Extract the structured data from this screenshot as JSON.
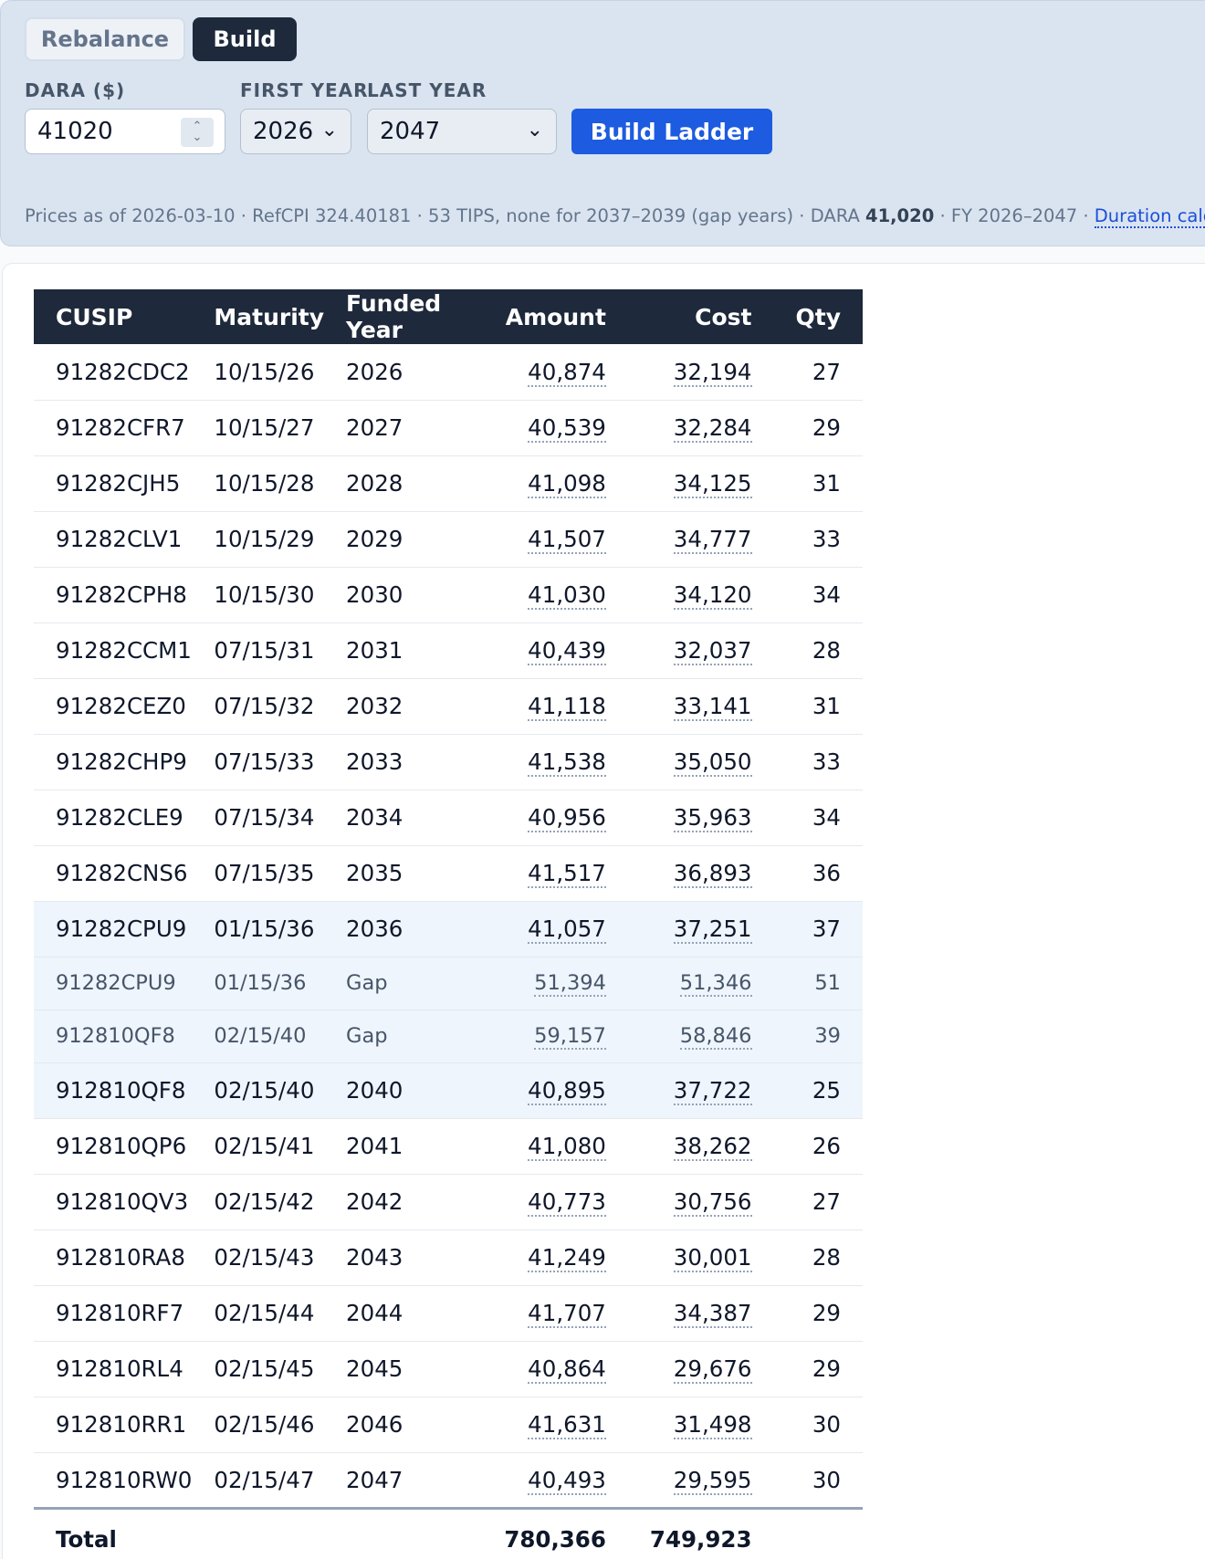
{
  "tabs": [
    {
      "label": "Rebalance",
      "active": false
    },
    {
      "label": "Build",
      "active": true
    }
  ],
  "form": {
    "dara_label": "DARA ($)",
    "dara_value": "41020",
    "first_year_label": "FIRST YEAR",
    "first_year_value": "2026",
    "last_year_label": "LAST YEAR",
    "last_year_value": "2047",
    "build_button": "Build Ladder"
  },
  "status": {
    "prefix": "Prices as of 2026-03-10 · RefCPI 324.40181 · 53 TIPS, none for 2037–2039 (gap years) · DARA ",
    "dara": "41,020",
    "fy": " · FY 2026–2047 · ",
    "link": "Duration calcs"
  },
  "table": {
    "columns": [
      "CUSIP",
      "Maturity",
      "Funded Year",
      "Amount",
      "Cost",
      "Qty"
    ],
    "rows": [
      {
        "cusip": "91282CDC2",
        "maturity": "10/15/26",
        "year": "2026",
        "amount": "40,874",
        "cost": "32,194",
        "qty": "27",
        "kind": "normal"
      },
      {
        "cusip": "91282CFR7",
        "maturity": "10/15/27",
        "year": "2027",
        "amount": "40,539",
        "cost": "32,284",
        "qty": "29",
        "kind": "normal"
      },
      {
        "cusip": "91282CJH5",
        "maturity": "10/15/28",
        "year": "2028",
        "amount": "41,098",
        "cost": "34,125",
        "qty": "31",
        "kind": "normal"
      },
      {
        "cusip": "91282CLV1",
        "maturity": "10/15/29",
        "year": "2029",
        "amount": "41,507",
        "cost": "34,777",
        "qty": "33",
        "kind": "normal"
      },
      {
        "cusip": "91282CPH8",
        "maturity": "10/15/30",
        "year": "2030",
        "amount": "41,030",
        "cost": "34,120",
        "qty": "34",
        "kind": "normal"
      },
      {
        "cusip": "91282CCM1",
        "maturity": "07/15/31",
        "year": "2031",
        "amount": "40,439",
        "cost": "32,037",
        "qty": "28",
        "kind": "normal"
      },
      {
        "cusip": "91282CEZ0",
        "maturity": "07/15/32",
        "year": "2032",
        "amount": "41,118",
        "cost": "33,141",
        "qty": "31",
        "kind": "normal"
      },
      {
        "cusip": "91282CHP9",
        "maturity": "07/15/33",
        "year": "2033",
        "amount": "41,538",
        "cost": "35,050",
        "qty": "33",
        "kind": "normal"
      },
      {
        "cusip": "91282CLE9",
        "maturity": "07/15/34",
        "year": "2034",
        "amount": "40,956",
        "cost": "35,963",
        "qty": "34",
        "kind": "normal"
      },
      {
        "cusip": "91282CNS6",
        "maturity": "07/15/35",
        "year": "2035",
        "amount": "41,517",
        "cost": "36,893",
        "qty": "36",
        "kind": "normal"
      },
      {
        "cusip": "91282CPU9",
        "maturity": "01/15/36",
        "year": "2036",
        "amount": "41,057",
        "cost": "37,251",
        "qty": "37",
        "kind": "hl"
      },
      {
        "cusip": "91282CPU9",
        "maturity": "01/15/36",
        "year": "Gap",
        "amount": "51,394",
        "cost": "51,346",
        "qty": "51",
        "kind": "gap"
      },
      {
        "cusip": "912810QF8",
        "maturity": "02/15/40",
        "year": "Gap",
        "amount": "59,157",
        "cost": "58,846",
        "qty": "39",
        "kind": "gap"
      },
      {
        "cusip": "912810QF8",
        "maturity": "02/15/40",
        "year": "2040",
        "amount": "40,895",
        "cost": "37,722",
        "qty": "25",
        "kind": "hl"
      },
      {
        "cusip": "912810QP6",
        "maturity": "02/15/41",
        "year": "2041",
        "amount": "41,080",
        "cost": "38,262",
        "qty": "26",
        "kind": "normal"
      },
      {
        "cusip": "912810QV3",
        "maturity": "02/15/42",
        "year": "2042",
        "amount": "40,773",
        "cost": "30,756",
        "qty": "27",
        "kind": "normal"
      },
      {
        "cusip": "912810RA8",
        "maturity": "02/15/43",
        "year": "2043",
        "amount": "41,249",
        "cost": "30,001",
        "qty": "28",
        "kind": "normal"
      },
      {
        "cusip": "912810RF7",
        "maturity": "02/15/44",
        "year": "2044",
        "amount": "41,707",
        "cost": "34,387",
        "qty": "29",
        "kind": "normal"
      },
      {
        "cusip": "912810RL4",
        "maturity": "02/15/45",
        "year": "2045",
        "amount": "40,864",
        "cost": "29,676",
        "qty": "29",
        "kind": "normal"
      },
      {
        "cusip": "912810RR1",
        "maturity": "02/15/46",
        "year": "2046",
        "amount": "41,631",
        "cost": "31,498",
        "qty": "30",
        "kind": "normal"
      },
      {
        "cusip": "912810RW0",
        "maturity": "02/15/47",
        "year": "2047",
        "amount": "40,493",
        "cost": "29,595",
        "qty": "30",
        "kind": "normal"
      }
    ],
    "total": {
      "label": "Total",
      "amount": "780,366",
      "cost": "749,923"
    }
  }
}
